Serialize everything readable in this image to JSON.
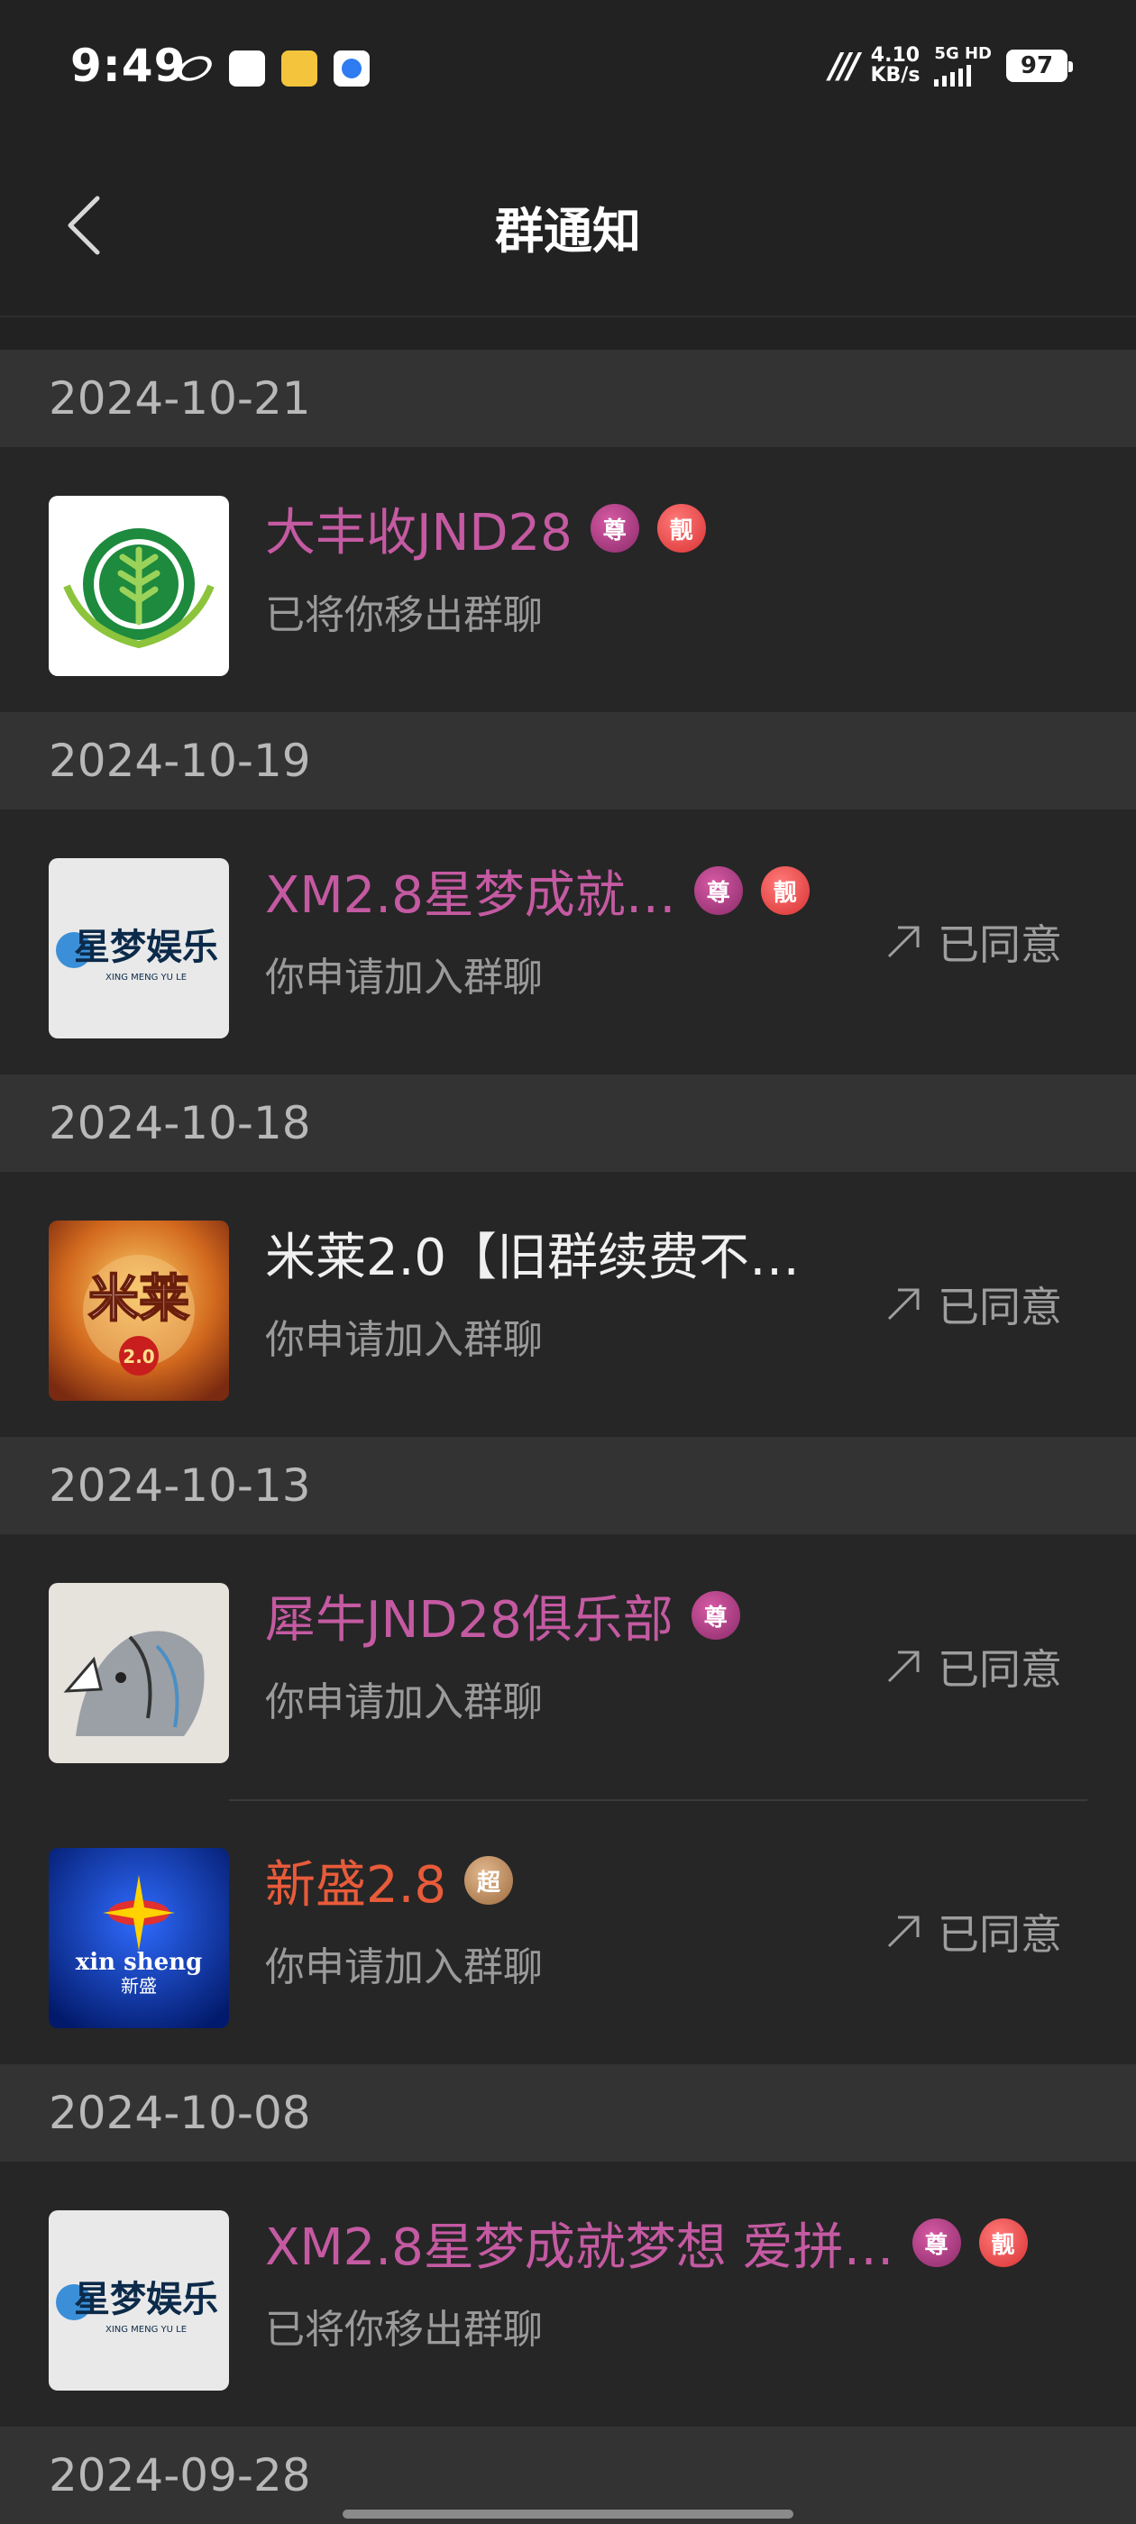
{
  "status": {
    "time": "9:49",
    "speed_value": "4.10",
    "speed_unit": "KB/s",
    "network": "5G HD",
    "battery": "97"
  },
  "header": {
    "title": "群通知"
  },
  "groups": [
    {
      "date": "2024-10-21",
      "items": [
        {
          "name": "大丰收JND28",
          "badges": [
            "尊",
            "靓"
          ],
          "sub": "已将你移出群聊",
          "status": "",
          "name_color": "#c45aa2"
        }
      ]
    },
    {
      "date": "2024-10-19",
      "items": [
        {
          "name": "XM2.8星梦成就…",
          "badges": [
            "尊",
            "靓"
          ],
          "sub": "你申请加入群聊",
          "status": "已同意",
          "name_color": "#c45aa2"
        }
      ]
    },
    {
      "date": "2024-10-18",
      "items": [
        {
          "name": "米莱2.0【旧群续费不…",
          "badges": [],
          "sub": "你申请加入群聊",
          "status": "已同意",
          "name_color": "#f0f0f0"
        }
      ]
    },
    {
      "date": "2024-10-13",
      "items": [
        {
          "name": "犀牛JND28俱乐部",
          "badges": [
            "尊"
          ],
          "sub": "你申请加入群聊",
          "status": "已同意",
          "name_color": "#c45aa2"
        },
        {
          "name": "新盛2.8",
          "badges": [
            "超"
          ],
          "sub": "你申请加入群聊",
          "status": "已同意",
          "name_color": "#e85b3a"
        }
      ]
    },
    {
      "date": "2024-10-08",
      "items": [
        {
          "name": "XM2.8星梦成就梦想 爱拼…",
          "badges": [
            "尊",
            "靓"
          ],
          "sub": "已将你移出群聊",
          "status": "",
          "name_color": "#c45aa2"
        }
      ]
    },
    {
      "date": "2024-09-28",
      "items": []
    }
  ],
  "avatars": {
    "a0": {
      "text": ""
    },
    "a1": {
      "brand": "星梦娱乐",
      "sub": "XING MENG YU LE"
    },
    "a2": {
      "brand": "米莱",
      "badge": "2.0"
    },
    "a3": {
      "text": ""
    },
    "a4": {
      "brand": "xin sheng",
      "cn": "新盛"
    },
    "a5": {
      "brand": "星梦娱乐",
      "sub": "XING MENG YU LE"
    }
  }
}
